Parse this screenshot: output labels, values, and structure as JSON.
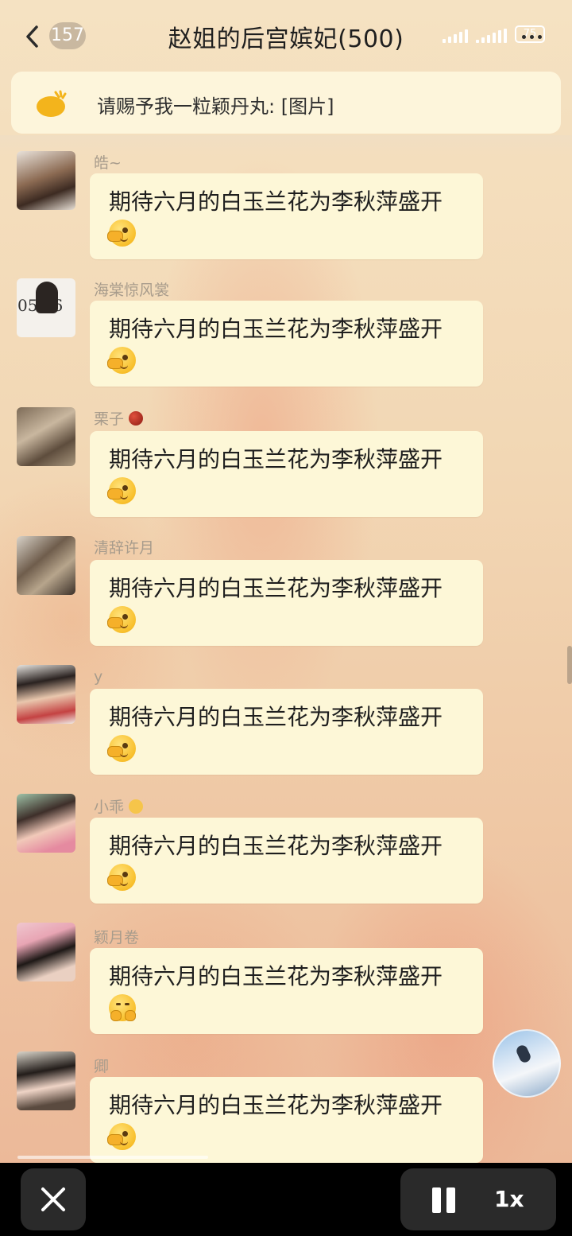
{
  "header": {
    "unread_count": "157",
    "title": "赵姐的后宫嫔妃(500)",
    "battery": "75"
  },
  "announcement": {
    "text": "请赐予我一粒颖丹丸: [图片]"
  },
  "messages": [
    {
      "nickname": "皓~",
      "text": "期待六月的白玉兰花为李秋萍盛开",
      "emoji": "face-with-hand-over-eye"
    },
    {
      "nickname": "海棠惊风裳",
      "text": "期待六月的白玉兰花为李秋萍盛开",
      "emoji": "face-with-hand-over-eye",
      "avatar_text": "05 06"
    },
    {
      "nickname": "栗子",
      "text": "期待六月的白玉兰花为李秋萍盛开",
      "emoji": "face-with-hand-over-eye"
    },
    {
      "nickname": "清辞许月",
      "text": "期待六月的白玉兰花为李秋萍盛开",
      "emoji": "face-with-hand-over-eye"
    },
    {
      "nickname": "y",
      "text": "期待六月的白玉兰花为李秋萍盛开",
      "emoji": "face-with-hand-over-eye"
    },
    {
      "nickname": "小乖",
      "text": "期待六月的白玉兰花为李秋萍盛开",
      "emoji": "face-with-hand-over-eye"
    },
    {
      "nickname": "颖月卷",
      "text": "期待六月的白玉兰花为李秋萍盛开",
      "emoji": "hugging-face"
    },
    {
      "nickname": "卿",
      "text": "期待六月的白玉兰花为李秋萍盛开",
      "emoji": "face-with-hand-over-eye"
    }
  ],
  "player": {
    "speed": "1x"
  },
  "colors": {
    "bubble": "#fdf7d7",
    "nickname": "#a89c8c",
    "player_bar": "#000000"
  }
}
